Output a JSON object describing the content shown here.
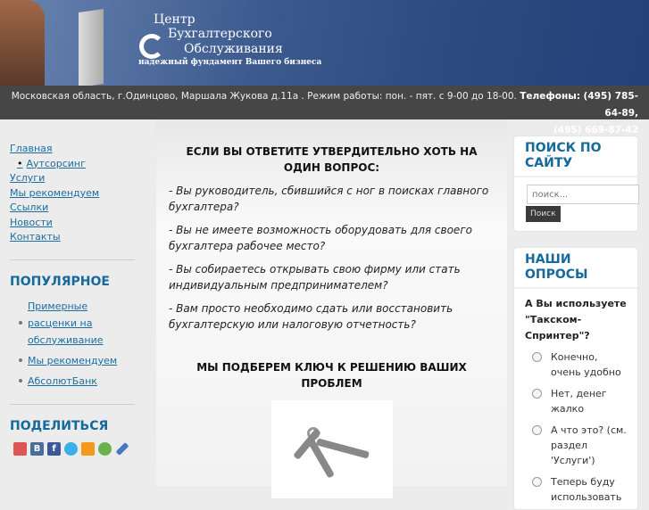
{
  "header": {
    "logo_line1": "Центр",
    "logo_line2": "Бухгалтерского",
    "logo_line3": "Обслуживания",
    "tagline": "надежный фундамент Вашего бизнеса"
  },
  "infobar": {
    "address": "Московская область, г.Одинцово, Маршала Жукова д.11а .  Режим работы: пон. - пят. с 9-00 до 18-00.",
    "phones_label": "Телефоны: (495) 785-64-89,",
    "phone2": "(495) 669-87-42"
  },
  "nav": [
    "Главная",
    "Аутсорсинг",
    "Услуги",
    "Мы рекомендуем",
    "Ссылки",
    "Новости",
    "Контакты"
  ],
  "popular": {
    "title": "ПОПУЛЯРНОЕ",
    "items": [
      "Примерные расценки на обслуживание",
      "Мы рекомендуем",
      "АбсолютБанк"
    ]
  },
  "share": {
    "title": "ПОДЕЛИТЬСЯ",
    "icons": [
      "google-buzz-icon",
      "vkontakte-icon",
      "facebook-icon",
      "twitter-icon",
      "odnoklassniki-icon",
      "moimir-icon",
      "livejournal-icon"
    ]
  },
  "main": {
    "heading": "ЕСЛИ ВЫ ОТВЕТИТЕ УТВЕРДИТЕЛЬНО ХОТЬ НА ОДИН ВОПРОС:",
    "points": [
      "- Вы руководитель, сбившийся с ног в поисках главного бухгалтера?",
      "- Вы не имеете возможность оборудовать для своего бухгалтера рабочее место?",
      "- Вы собираетесь открывать свою фирму или стать индивидуальным предпринимателем?",
      "- Вам просто необходимо сдать или восстановить бухгалтерскую или налоговую отчетность?"
    ],
    "heading2": "МЫ ПОДБЕРЕМ КЛЮЧ К РЕШЕНИЮ ВАШИХ ПРОБЛЕМ"
  },
  "search": {
    "title": "ПОИСК ПО САЙТУ",
    "placeholder": "поиск...",
    "button": "Поиск"
  },
  "poll": {
    "title": "НАШИ ОПРОСЫ",
    "question": "А Вы используете \"Такском-Спринтер\"?",
    "options": [
      "Конечно, очень удобно",
      "Нет, денег жалко",
      "А что это? (см. раздел 'Услуги')",
      "Теперь буду использовать"
    ]
  }
}
